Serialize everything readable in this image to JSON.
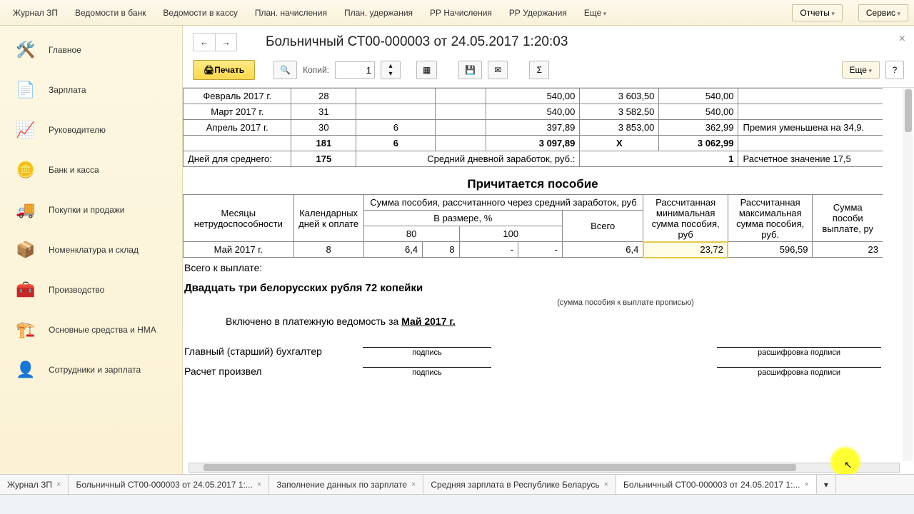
{
  "top_menu": {
    "items": [
      "Журнал ЗП",
      "Ведомости в банк",
      "Ведомости в кассу",
      "План. начисления",
      "План. удержания",
      "РР Начисления",
      "РР Удержания"
    ],
    "more": "Еще",
    "reports": "Отчеты",
    "service": "Сервис"
  },
  "sidebar": {
    "items": [
      {
        "label": "Главное",
        "icon": "🛠️"
      },
      {
        "label": "Зарплата",
        "icon": "📄"
      },
      {
        "label": "Руководителю",
        "icon": "📈"
      },
      {
        "label": "Банк и касса",
        "icon": "🪙"
      },
      {
        "label": "Покупки и продажи",
        "icon": "🚚"
      },
      {
        "label": "Номенклатура и склад",
        "icon": "📦"
      },
      {
        "label": "Производство",
        "icon": "🧰"
      },
      {
        "label": "Основные средства и НМА",
        "icon": "🏗️"
      },
      {
        "label": "Сотрудники и зарплата",
        "icon": "👤"
      }
    ]
  },
  "doc": {
    "title": "Больничный СТ00-000003 от 24.05.2017 1:20:03",
    "close": "×",
    "nav_back": "←",
    "nav_fwd": "→"
  },
  "toolbar": {
    "print": "Печать",
    "copies_label": "Копий:",
    "copies_value": "1",
    "more": "Еще",
    "help": "?"
  },
  "table1": {
    "rows": [
      {
        "month": "Февраль 2017 г.",
        "days": "28",
        "extra": "",
        "c4": "",
        "sum1": "540,00",
        "sum2": "3 603,50",
        "sum3": "540,00",
        "note": ""
      },
      {
        "month": "Март 2017 г.",
        "days": "31",
        "extra": "",
        "c4": "",
        "sum1": "540,00",
        "sum2": "3 582,50",
        "sum3": "540,00",
        "note": ""
      },
      {
        "month": "Апрель 2017 г.",
        "days": "30",
        "extra": "6",
        "c4": "",
        "sum1": "397,89",
        "sum2": "3 853,00",
        "sum3": "362,99",
        "note": "Премия уменьшена на 34,9."
      }
    ],
    "totals": {
      "days": "181",
      "extra": "6",
      "c4": "",
      "sum1": "3 097,89",
      "sum2": "X",
      "sum3": "3 062,99"
    },
    "footer": {
      "days_label": "Дней для среднего:",
      "days_value": "175",
      "avg_label": "Средний дневной заработок, руб.:",
      "avg_value": "1",
      "calc_note": "Расчетное значение 17,5"
    }
  },
  "section2": {
    "title": "Причитается пособие",
    "headers": {
      "h1": "Месяцы нетрудоспособности",
      "h2": "Календарных дней к оплате",
      "h3": "Сумма пособия, рассчитанного через средний заработок, руб",
      "h3a": "В размере, %",
      "h3a1": "80",
      "h3a2": "100",
      "h3b": "Всего",
      "h4": "Рассчитанная минимальная сумма пособия, руб",
      "h5": "Рассчитанная максимальная сумма пособия, руб.",
      "h6": "Сумма пособи выплате, ру"
    },
    "row": {
      "month": "Май 2017 г.",
      "days": "8",
      "p80a": "6,4",
      "p80b": "8",
      "p100": "-",
      "p100b": "-",
      "total": "6,4",
      "min": "23,72",
      "max": "596,59",
      "pay": "23"
    }
  },
  "payout": {
    "label": "Всего к выплате:",
    "words": "Двадцать три белорусских рубля 72 копейки",
    "words_note": "(сумма пособия к выплате прописью)",
    "included_prefix": "Включено в платежную ведомость за ",
    "included_period": "Май 2017 г."
  },
  "signatures": {
    "accountant": "Главный (старший) бухгалтер",
    "calc_by": "Расчет произвел",
    "sign": "подпись",
    "decode": "расшифровка подписи"
  },
  "bottom_tabs": [
    "Журнал ЗП",
    "Больничный СТ00-000003 от 24.05.2017 1:...",
    "Заполнение данных по зарплате",
    "Средняя зарплата в Республике Беларусь",
    "Больничный СТ00-000003 от 24.05.2017 1:..."
  ]
}
